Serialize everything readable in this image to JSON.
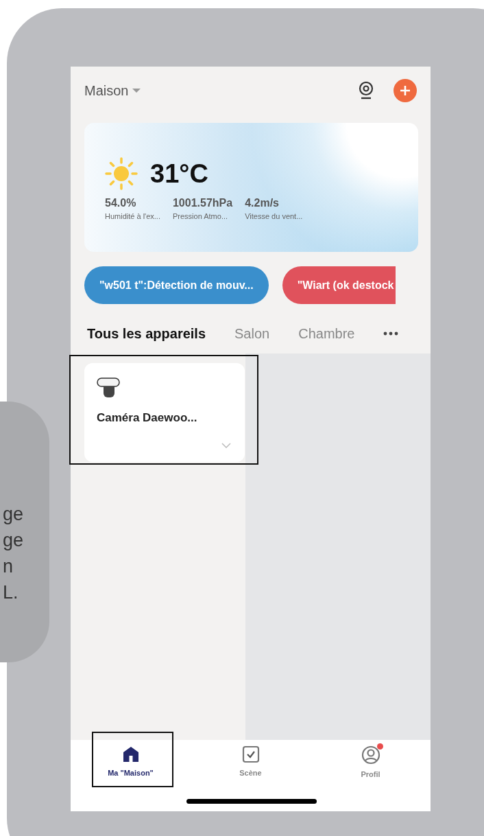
{
  "header": {
    "home": "Maison"
  },
  "weather": {
    "temperature": "31°C",
    "stats": [
      {
        "value": "54.0%",
        "label": "Humidité à l'ex..."
      },
      {
        "value": "1001.57hPa",
        "label": "Pression Atmo..."
      },
      {
        "value": "4.2m/s",
        "label": "Vitesse du vent..."
      }
    ]
  },
  "scenes": [
    {
      "label": "\"w501 t\":Détection de mouv...",
      "color": "#3a8fcc"
    },
    {
      "label": "\"Wiart (ok destock",
      "color": "#e0525c"
    }
  ],
  "rooms": [
    {
      "label": "Tous les appareils",
      "selected": true
    },
    {
      "label": "Salon",
      "selected": false
    },
    {
      "label": "Chambre",
      "selected": false
    }
  ],
  "devices": [
    {
      "name": "Caméra Daewoo..."
    }
  ],
  "nav": [
    {
      "kind": "home",
      "label": "Ma \"Maison\"",
      "selected": true,
      "badge": false
    },
    {
      "kind": "scene",
      "label": "Scène",
      "selected": false,
      "badge": false
    },
    {
      "kind": "profile",
      "label": "Profil",
      "selected": false,
      "badge": true
    }
  ],
  "callout": {
    "lines": [
      "ge",
      "ge",
      "n",
      "L."
    ]
  }
}
